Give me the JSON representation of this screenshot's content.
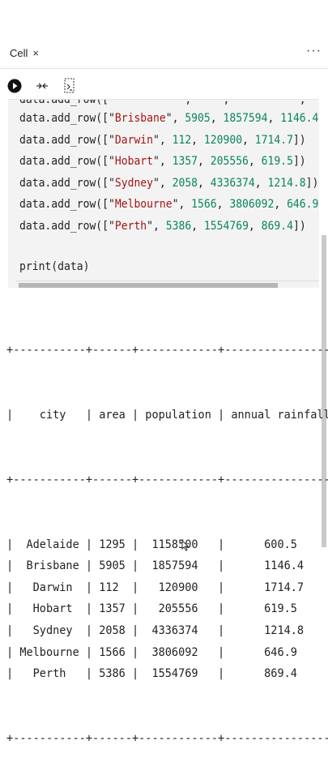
{
  "tab": {
    "label": "Cell",
    "close_glyph": "×",
    "more_glyph": "···"
  },
  "toolbar": {
    "icons": [
      "run-icon",
      "collapse-icon",
      "output-icon"
    ]
  },
  "code": {
    "partial_top": "data.add_row([\"          \",     ,           ,        ]",
    "rows": [
      {
        "city": "Brisbane",
        "area": "5905",
        "population": "1857594",
        "rain": "1146.4"
      },
      {
        "city": "Darwin",
        "area": "112",
        "population": "120900",
        "rain": "1714.7"
      },
      {
        "city": "Hobart",
        "area": "1357",
        "population": "205556",
        "rain": "619.5"
      },
      {
        "city": "Sydney",
        "area": "2058",
        "population": "4336374",
        "rain": "1214.8"
      },
      {
        "city": "Melbourne",
        "area": "1566",
        "population": "3806092",
        "rain": "646.9"
      },
      {
        "city": "Perth",
        "area": "5386",
        "population": "1554769",
        "rain": "869.4"
      }
    ],
    "print_statement": "print(data)"
  },
  "output": {
    "border": "+-----------+------+------------+-----------------+",
    "header": "|    city   | area | population | annual rainfall |",
    "lines": [
      "|  Adelaide | 1295 |  1158500   |      600.5      |",
      "|  Brisbane | 5905 |  1857594   |      1146.4     |",
      "|   Darwin  | 112  |   120900   |      1714.7     |",
      "|   Hobart  | 1357 |   205556   |      619.5      |",
      "|   Sydney  | 2058 |  4336374   |      1214.8     |",
      "| Melbourne | 1566 |  3806092   |      646.9      |",
      "|   Perth   | 5386 |  1554769   |      869.4      |"
    ]
  }
}
